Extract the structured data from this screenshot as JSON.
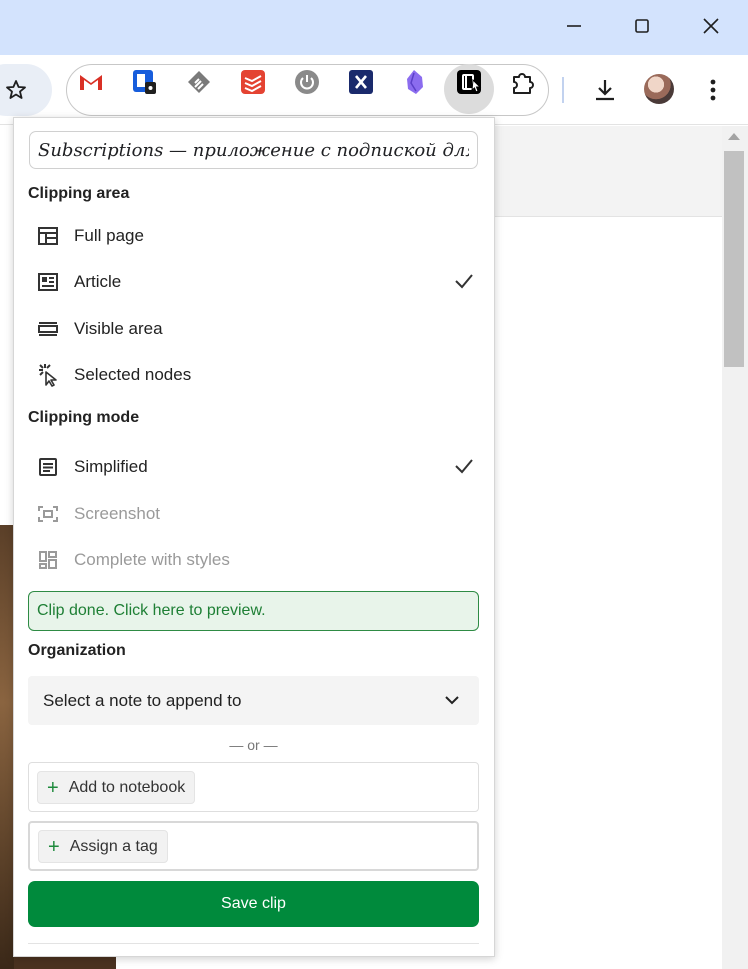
{
  "window": {
    "controls": [
      "minimize-icon",
      "maximize-icon",
      "close-icon"
    ]
  },
  "toolbar": {
    "bookmark_icon": "star-icon",
    "extensions": [
      {
        "name": "gmail-icon",
        "color": "#d93025"
      },
      {
        "name": "bitwarden-icon",
        "color": "#175ddc"
      },
      {
        "name": "feedly-icon",
        "color": "#7a7a7a"
      },
      {
        "name": "todoist-icon",
        "color": "#e44332"
      },
      {
        "name": "power-icon",
        "color": "#8a8a8a"
      },
      {
        "name": "x-extension-icon",
        "color": "#1a2a6c"
      },
      {
        "name": "obsidian-icon",
        "color": "#8b6cef"
      },
      {
        "name": "evernote-clipper-icon",
        "color": "#000000"
      }
    ],
    "puzzle_icon": "extensions-puzzle-icon",
    "download_icon": "download-icon",
    "profile_icon": "avatar",
    "menu_icon": "kebab-menu-icon"
  },
  "popup": {
    "title_value": "Subscriptions — приложение с подпиской для тр",
    "clipping_area": {
      "heading": "Clipping area",
      "options": [
        {
          "label": "Full page",
          "icon": "full-page-icon",
          "checked": false,
          "disabled": false
        },
        {
          "label": "Article",
          "icon": "article-icon",
          "checked": true,
          "disabled": false
        },
        {
          "label": "Visible area",
          "icon": "visible-area-icon",
          "checked": false,
          "disabled": false
        },
        {
          "label": "Selected nodes",
          "icon": "selected-nodes-icon",
          "checked": false,
          "disabled": false
        }
      ]
    },
    "clipping_mode": {
      "heading": "Clipping mode",
      "options": [
        {
          "label": "Simplified",
          "icon": "simplified-icon",
          "checked": true,
          "disabled": false
        },
        {
          "label": "Screenshot",
          "icon": "screenshot-icon",
          "checked": false,
          "disabled": true
        },
        {
          "label": "Complete with styles",
          "icon": "complete-styles-icon",
          "checked": false,
          "disabled": true
        }
      ]
    },
    "clip_done": "Clip done. Click here to preview.",
    "organization": {
      "heading": "Organization",
      "note_select": "Select a note to append to",
      "or_text": "— or —",
      "add_notebook": "Add to notebook",
      "assign_tag": "Assign a tag"
    },
    "save_label": "Save clip",
    "colors": {
      "accent_green": "#008a3c",
      "banner_bg": "#e8f4ea",
      "titlebar": "#d3e3fd"
    }
  }
}
